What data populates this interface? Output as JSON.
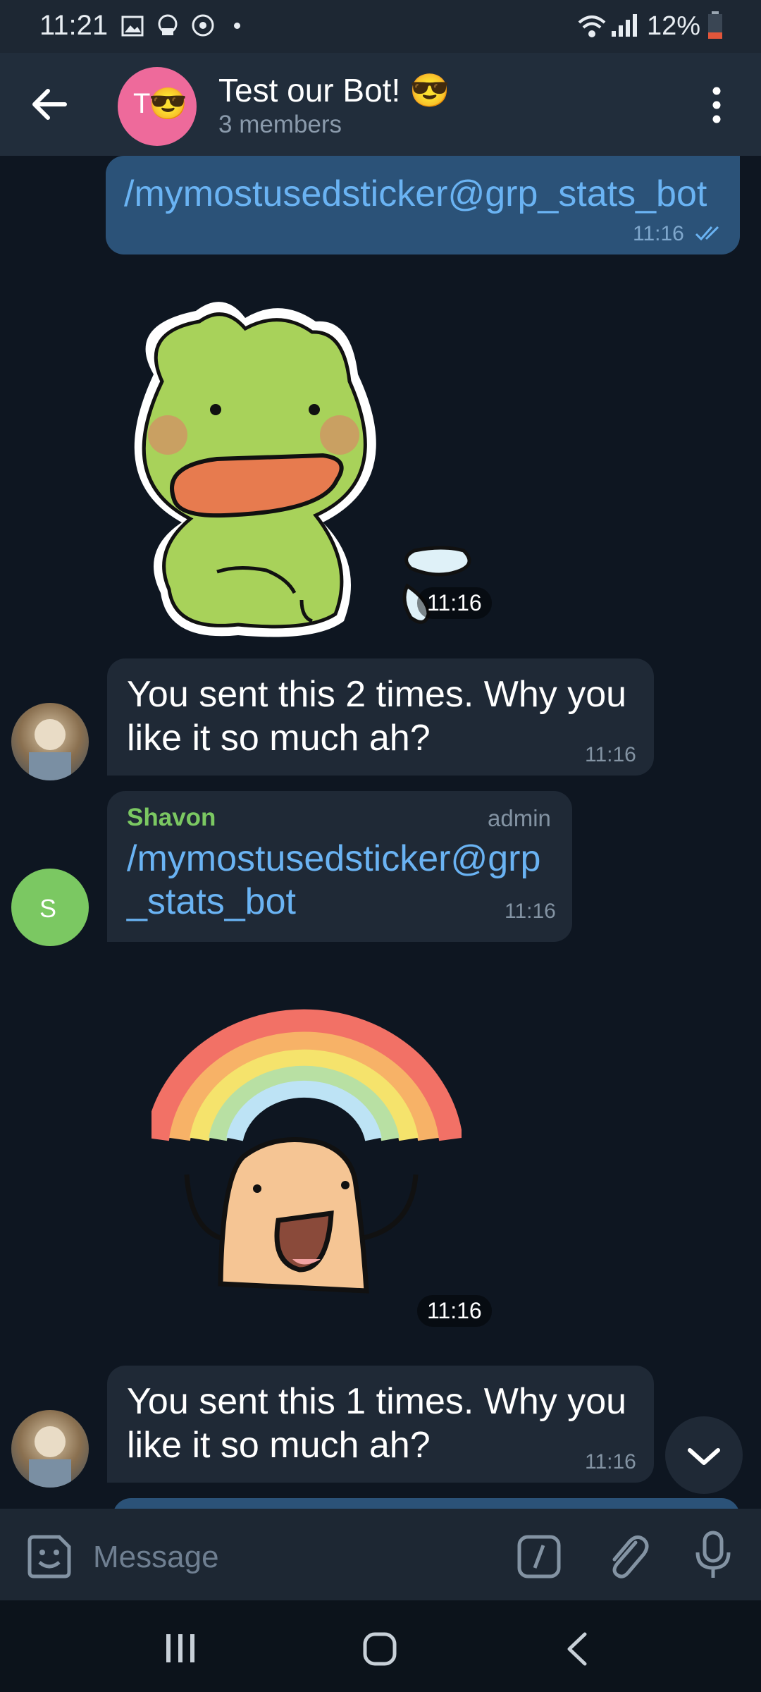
{
  "status_bar": {
    "time": "11:21",
    "battery": "12%"
  },
  "header": {
    "title": "Test our Bot! 😎",
    "subtitle": "3 members",
    "avatar_letter": "T",
    "avatar_emoji": "😎"
  },
  "messages": {
    "m1": {
      "text": "/mymostusedsticker@grp_stats_bot",
      "time": "11:16"
    },
    "sticker1": {
      "time": "11:16"
    },
    "m2": {
      "line1": "You sent this 2 times. Why you",
      "line2": "like it so much ah?",
      "time": "11:16"
    },
    "m3": {
      "sender": "Shavon",
      "role": "admin",
      "line1": "/mymostusedsticker@grp",
      "line2": "_stats_bot",
      "time": "11:16",
      "avatar_letter": "S"
    },
    "sticker2": {
      "time": "11:16"
    },
    "m4": {
      "line1": "You sent this 1 times. Why you",
      "line2": "like it so much ah?",
      "time": "11:16"
    }
  },
  "composer": {
    "placeholder": "Message"
  },
  "colors": {
    "accent_out": "#2b5278",
    "link": "#6ab3f3",
    "sender_green": "#7bc862",
    "avatar_pink": "#ee6a9b"
  }
}
